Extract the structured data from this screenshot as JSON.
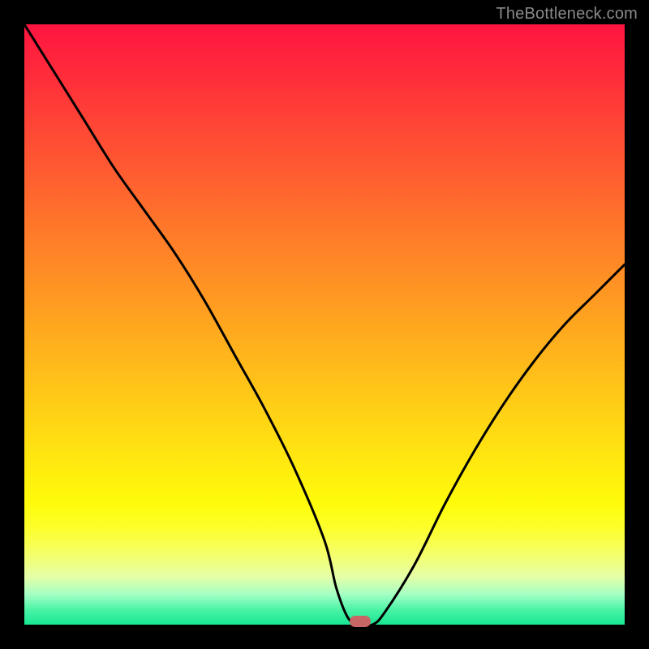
{
  "watermark": "TheBottleneck.com",
  "chart_data": {
    "type": "line",
    "title": "",
    "xlabel": "",
    "ylabel": "",
    "xlim": [
      0,
      100
    ],
    "ylim": [
      0,
      100
    ],
    "x": [
      0,
      5,
      10,
      15,
      20,
      25,
      30,
      35,
      40,
      45,
      50,
      52,
      54,
      56,
      58,
      60,
      65,
      70,
      75,
      80,
      85,
      90,
      95,
      100
    ],
    "values": [
      100,
      92,
      84,
      76,
      69,
      62,
      54,
      45,
      36,
      26,
      14,
      6,
      1,
      0,
      0,
      2,
      10,
      20,
      29,
      37,
      44,
      50,
      55,
      60
    ],
    "marker": {
      "x": 56,
      "y": 0
    },
    "background_gradient": {
      "top": "#ff1440",
      "mid": "#ffd500",
      "bottom": "#17e793"
    }
  }
}
